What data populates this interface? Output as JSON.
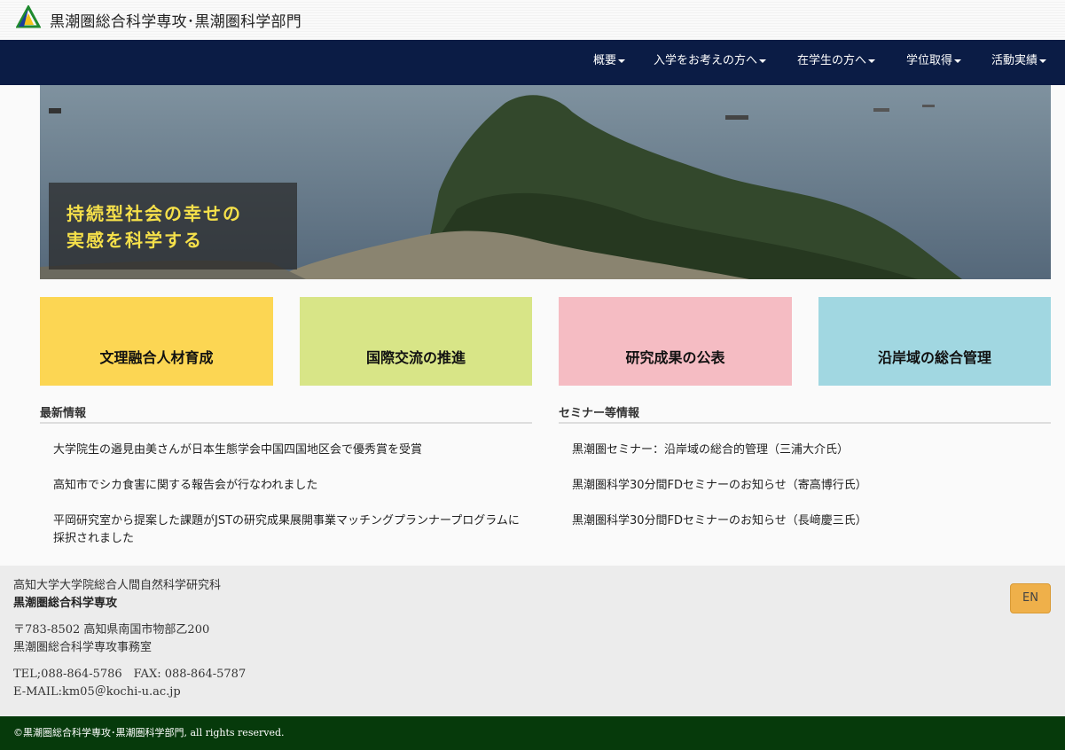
{
  "site": {
    "title": "黒潮圏総合科学専攻･黒潮圏科学部門"
  },
  "nav": {
    "items": [
      {
        "label": "概要"
      },
      {
        "label": "入学をお考えの方へ"
      },
      {
        "label": "在学生の方へ"
      },
      {
        "label": "学位取得"
      },
      {
        "label": "活動実績"
      }
    ]
  },
  "hero": {
    "line1": "持続型社会の幸せの",
    "line2": "実感を科学する"
  },
  "cards": [
    {
      "label": "文理融合人材育成",
      "color": "#fcd653"
    },
    {
      "label": "国際交流の推進",
      "color": "#d8e587"
    },
    {
      "label": "研究成果の公表",
      "color": "#f5bcc3"
    },
    {
      "label": "沿岸域の総合管理",
      "color": "#a1d7e1"
    }
  ],
  "news": {
    "heading": "最新情報",
    "items": [
      {
        "text": "大学院生の邉見由美さんが日本生態学会中国四国地区会で優秀賞を受賞"
      },
      {
        "text": "高知市でシカ食害に関する報告会が行なわれました"
      },
      {
        "text": "平岡研究室から提案した課題がJSTの研究成果展開事業マッチングプランナープログラムに採択されました"
      }
    ]
  },
  "seminar": {
    "heading": "セミナー等情報",
    "items": [
      {
        "text": "黒潮圏セミナー：沿岸域の総合的管理（三浦大介氏）"
      },
      {
        "text": "黒潮圏科学30分間FDセミナーのお知らせ（寄高博行氏）"
      },
      {
        "text": "黒潮圏科学30分間FDセミナーのお知らせ（長﨑慶三氏）"
      }
    ]
  },
  "footer": {
    "line1": "高知大学大学院総合人間自然科学研究科",
    "line2": "黒潮圏総合科学専攻",
    "line3": "〒783-8502 高知県南国市物部乙200",
    "line4": "黒潮圏総合科学専攻事務室",
    "line5": "TEL;088-864-5786　FAX: 088-864-5787",
    "line6": "E-MAIL:km05＠kochi-u.ac.jp",
    "lang_button": "EN"
  },
  "copyright": "©黒潮圏総合科学専攻･黒潮圏科学部門, all rights reserved."
}
